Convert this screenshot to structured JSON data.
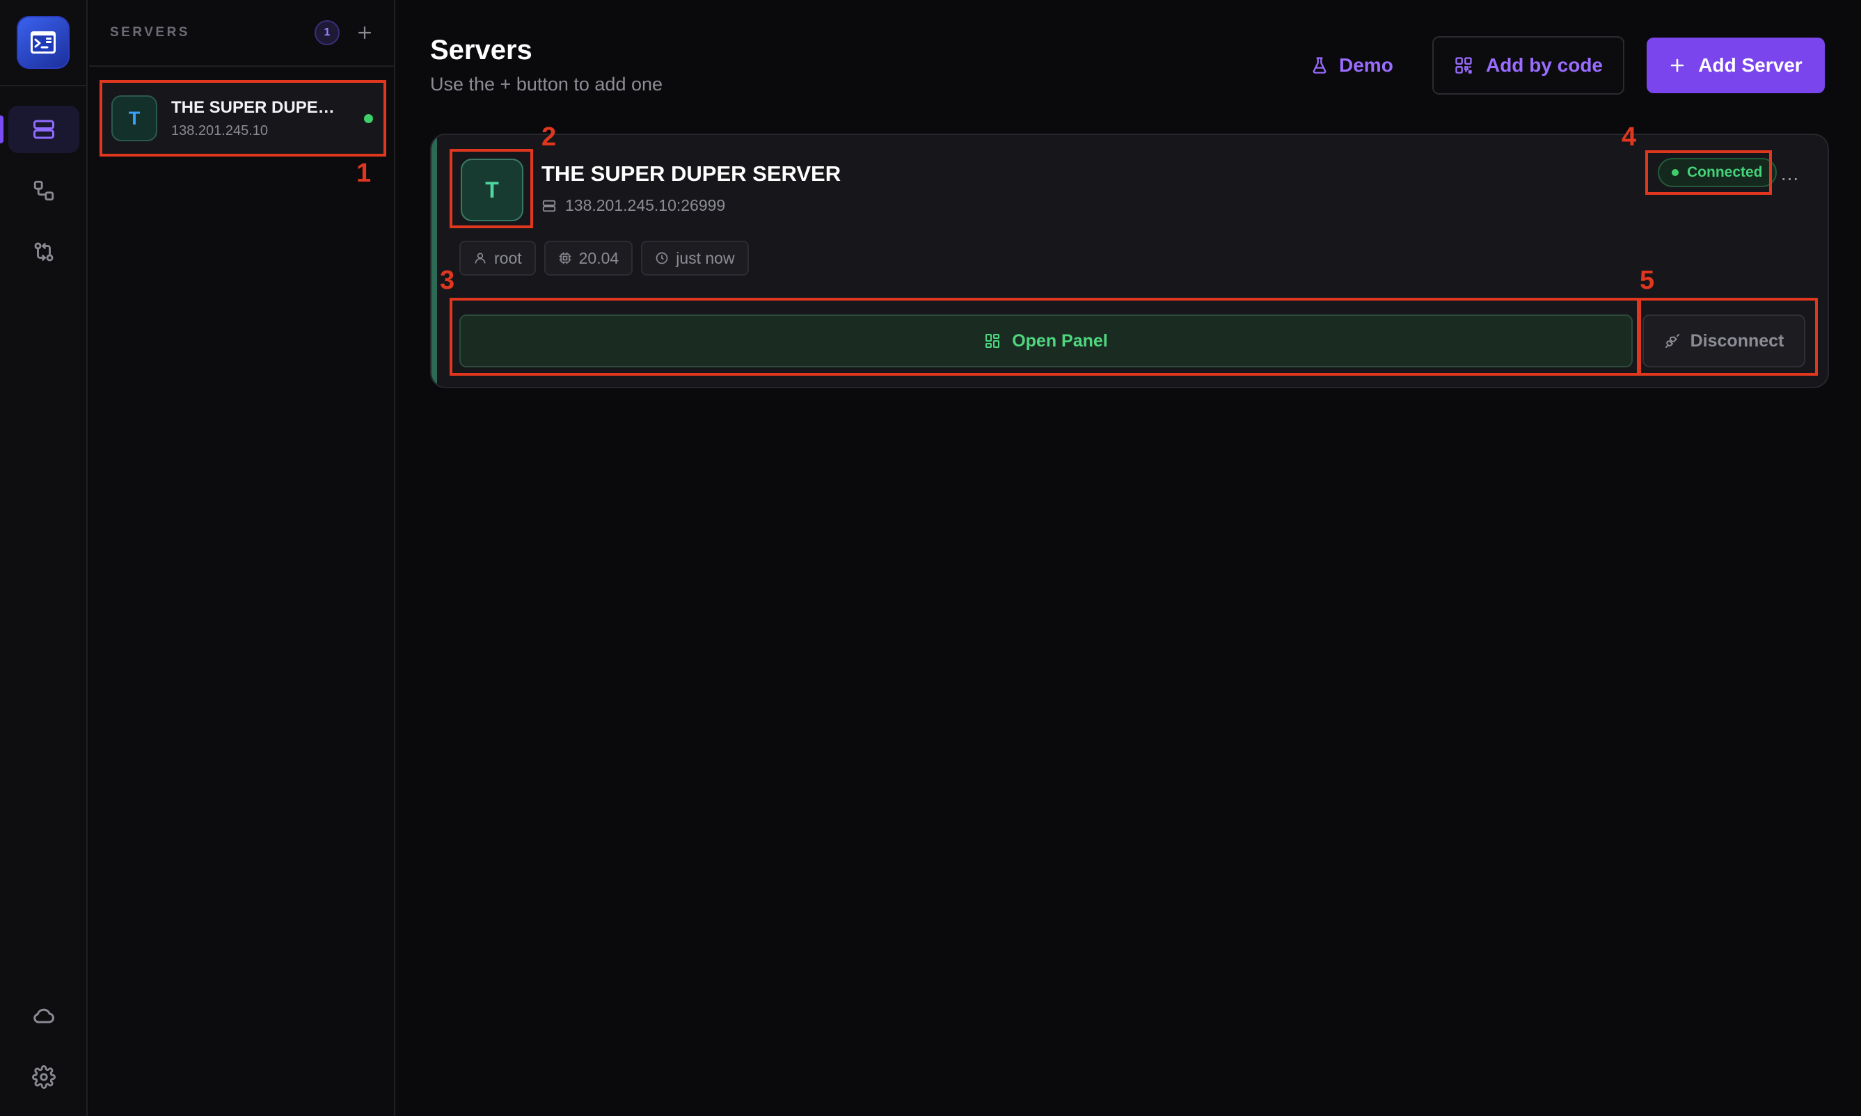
{
  "rail": {
    "items": [
      {
        "name": "servers",
        "active": true
      },
      {
        "name": "topology",
        "active": false
      },
      {
        "name": "transfer",
        "active": false
      }
    ],
    "bottom": [
      {
        "name": "cloud"
      },
      {
        "name": "settings"
      }
    ]
  },
  "sidebar": {
    "title": "SERVERS",
    "count": "1",
    "items": [
      {
        "initial": "T",
        "name": "THE SUPER DUPER SERVER",
        "ip": "138.201.245.10",
        "status_color": "#3ecf6a"
      }
    ]
  },
  "header": {
    "title": "Servers",
    "subtitle": "Use the + button to add one",
    "demo_label": "Demo",
    "add_by_code_label": "Add by code",
    "add_server_label": "Add Server"
  },
  "card": {
    "initial": "T",
    "name": "THE SUPER DUPER SERVER",
    "address": "138.201.245.10:26999",
    "status": "Connected",
    "more": "...",
    "tags": {
      "user": "root",
      "version": "20.04",
      "last_seen": "just now"
    },
    "open_panel_label": "Open Panel",
    "disconnect_label": "Disconnect"
  },
  "annotations": [
    "1",
    "2",
    "3",
    "4",
    "5"
  ],
  "colors": {
    "accent": "#7a45ec",
    "success": "#3ecf6a",
    "annotation": "#e2371f"
  }
}
